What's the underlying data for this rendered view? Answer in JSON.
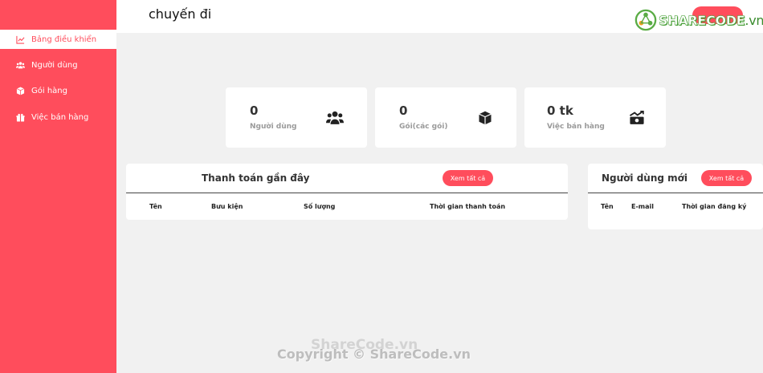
{
  "header": {
    "title": "chuyến đi"
  },
  "logo": {
    "brand": "SHARE",
    "brand2": "CODE",
    "tld": ".vn"
  },
  "sidebar": {
    "items": [
      {
        "label": "Bảng điều khiển",
        "icon": "line-chart-icon",
        "active": true
      },
      {
        "label": "Người dùng",
        "icon": "users-icon",
        "active": false
      },
      {
        "label": "Gói hàng",
        "icon": "box-icon",
        "active": false
      },
      {
        "label": "Việc bán hàng",
        "icon": "gift-icon",
        "active": false
      }
    ]
  },
  "stats": [
    {
      "value": "0",
      "label": "Người dùng",
      "icon": "users-icon"
    },
    {
      "value": "0",
      "label": "Gói(các gói)",
      "icon": "box-icon"
    },
    {
      "value": "0 tk",
      "label": "Việc bán hàng",
      "icon": "money-chart-icon"
    }
  ],
  "recent_payments": {
    "title": "Thanh toán gần đây",
    "view_all": "Xem tất cả",
    "columns": [
      "Tên",
      "Bưu kiện",
      "Số lượng",
      "Thời gian thanh toán"
    ]
  },
  "new_users": {
    "title": "Người dùng mới",
    "view_all": "Xem tất cả",
    "columns": [
      "Tên",
      "E-mail",
      "Thời gian đăng ký"
    ]
  },
  "watermark": {
    "line1": "ShareCode.vn",
    "line2": "Copyright © ShareCode.vn"
  },
  "colors": {
    "accent": "#ff4d5c",
    "background": "#f1f1f1",
    "card": "#ffffff"
  }
}
